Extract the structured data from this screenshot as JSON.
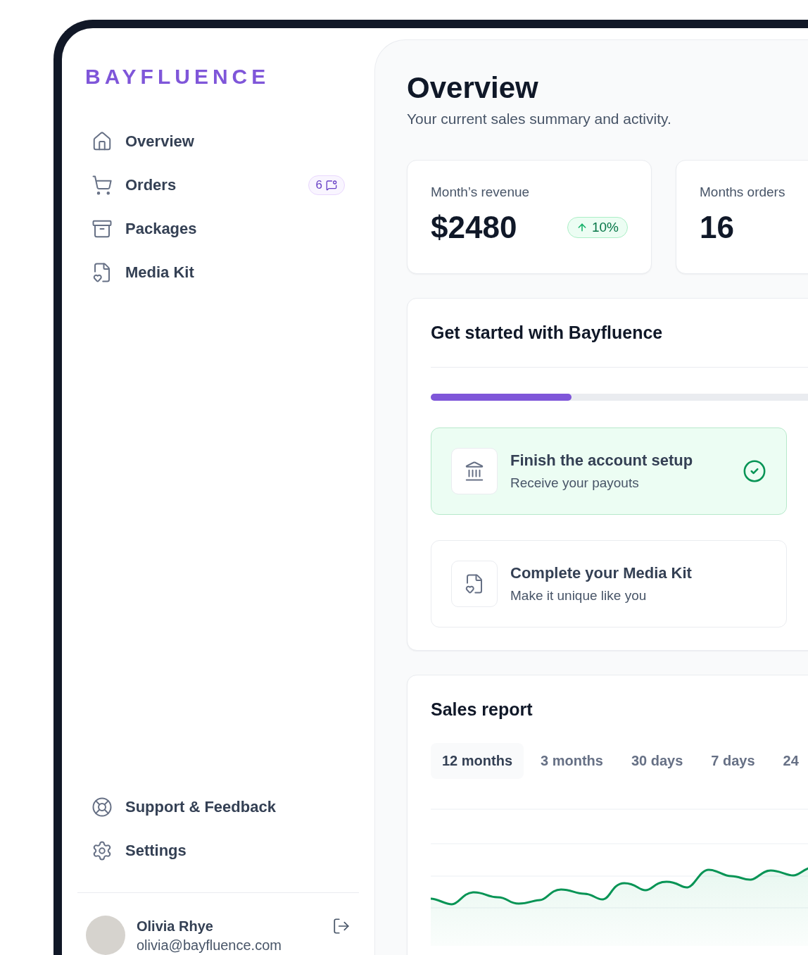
{
  "brand": {
    "logo": "BAYFLUENCE"
  },
  "nav": [
    {
      "label": "Overview"
    },
    {
      "label": "Orders",
      "badge": "6"
    },
    {
      "label": "Packages"
    },
    {
      "label": "Media Kit"
    }
  ],
  "footer_nav": [
    {
      "label": "Support & Feedback"
    },
    {
      "label": "Settings"
    }
  ],
  "user": {
    "name": "Olivia Rhye",
    "email": "olivia@bayfluence.com"
  },
  "header": {
    "title": "Overview",
    "subtitle": "Your current sales summary and activity."
  },
  "stats": [
    {
      "label": "Month’s revenue",
      "value": "$2480",
      "change": "10%"
    },
    {
      "label": "Months orders",
      "value": "16"
    }
  ],
  "get_started": {
    "title": "Get started with Bayfluence",
    "level": 0.33,
    "tasks": [
      {
        "title": "Finish the account setup",
        "subtitle": "Receive your payouts",
        "completed": true
      },
      {
        "title": "Complete your Media Kit",
        "subtitle": "Make it unique like you",
        "completed": false
      }
    ]
  },
  "sales_report": {
    "title": "Sales report",
    "tabs": [
      {
        "label": "12 months",
        "selected": true
      },
      {
        "label": "3 months",
        "selected": false
      },
      {
        "label": "30 days",
        "selected": false
      },
      {
        "label": "7 days",
        "selected": false
      },
      {
        "label": "24",
        "selected": false
      }
    ]
  }
}
